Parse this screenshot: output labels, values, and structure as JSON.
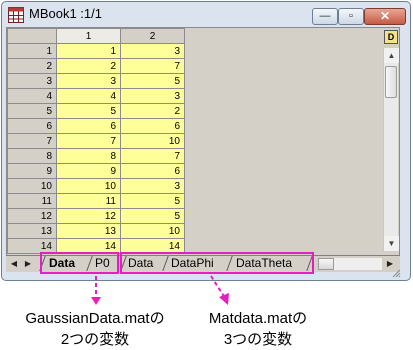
{
  "window": {
    "title": "MBook1 :1/1",
    "minimize_glyph": "—",
    "restore_glyph": "▫",
    "close_glyph": "✕",
    "d_icon_label": "D"
  },
  "grid": {
    "columns": [
      "1",
      "2"
    ],
    "rows": [
      {
        "row": "1",
        "c1": "1",
        "c2": "3"
      },
      {
        "row": "2",
        "c1": "2",
        "c2": "7"
      },
      {
        "row": "3",
        "c1": "3",
        "c2": "5"
      },
      {
        "row": "4",
        "c1": "4",
        "c2": "3"
      },
      {
        "row": "5",
        "c1": "5",
        "c2": "2"
      },
      {
        "row": "6",
        "c1": "6",
        "c2": "6"
      },
      {
        "row": "7",
        "c1": "7",
        "c2": "10"
      },
      {
        "row": "8",
        "c1": "8",
        "c2": "7"
      },
      {
        "row": "9",
        "c1": "9",
        "c2": "6"
      },
      {
        "row": "10",
        "c1": "10",
        "c2": "3"
      },
      {
        "row": "11",
        "c1": "11",
        "c2": "5"
      },
      {
        "row": "12",
        "c1": "12",
        "c2": "5"
      },
      {
        "row": "13",
        "c1": "13",
        "c2": "10"
      },
      {
        "row": "14",
        "c1": "14",
        "c2": "14"
      }
    ]
  },
  "tabs": {
    "group1": [
      "Data",
      "P0"
    ],
    "group2": [
      "Data",
      "DataPhi",
      "DataTheta"
    ],
    "nav_first": "◀",
    "nav_next": "▶"
  },
  "callouts": {
    "left_line1": "GaussianData.matの",
    "left_line2": "2つの変数",
    "right_line1": "Matdata.matの",
    "right_line2": "3つの変数"
  },
  "colors": {
    "highlight": "#e41fbf",
    "cell_fill": "#ffff99"
  },
  "icons": {
    "app": "matrix-book-icon",
    "arrow_up": "scroll-up-arrow-icon",
    "arrow_down": "scroll-down-arrow-icon",
    "grip": "resize-grip-icon"
  }
}
